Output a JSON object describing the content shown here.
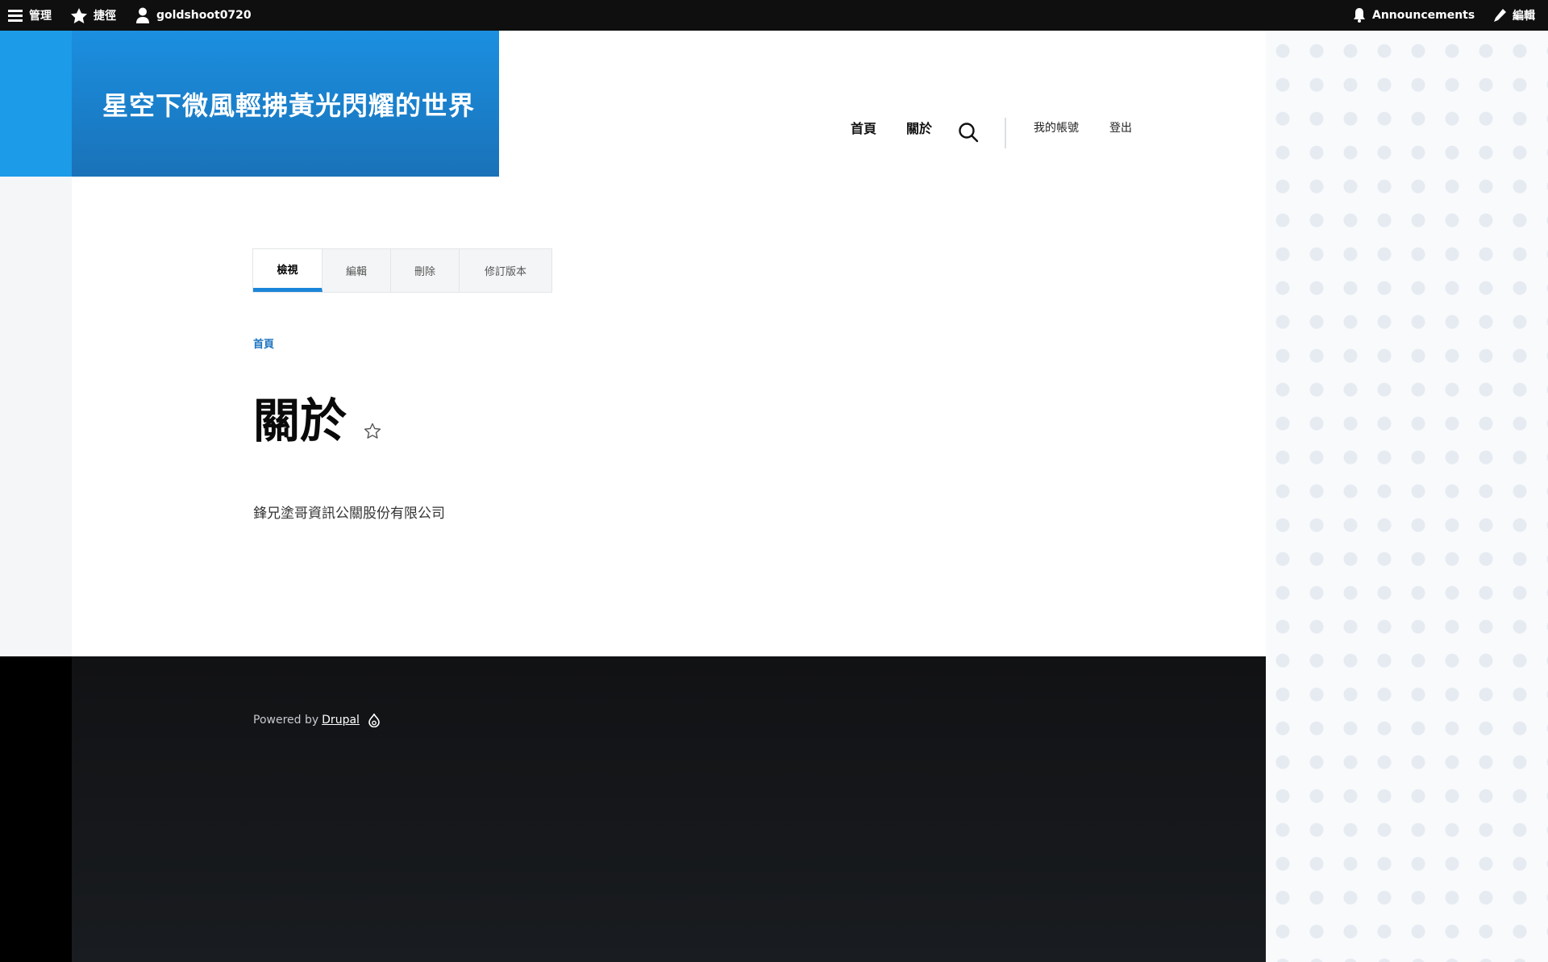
{
  "toolbar": {
    "manage": "管理",
    "shortcuts": "捷徑",
    "user": "goldshoot0720",
    "announcements": "Announcements",
    "edit": "編輯"
  },
  "site": {
    "name": "星空下微風輕拂黃光閃耀的世界"
  },
  "main_nav": {
    "home": "首頁",
    "about": "關於"
  },
  "account_nav": {
    "my_account": "我的帳號",
    "logout": "登出"
  },
  "tabs": [
    {
      "label": "檢視",
      "active": true
    },
    {
      "label": "編輯"
    },
    {
      "label": "刪除"
    },
    {
      "label": "修訂版本"
    }
  ],
  "breadcrumb": {
    "home": "首頁"
  },
  "page": {
    "title": "關於",
    "body": "鋒兄塗哥資訊公關股份有限公司"
  },
  "footer": {
    "powered_by": "Powered by",
    "drupal": "Drupal"
  },
  "colors": {
    "brand_blue": "#1b8fe0",
    "tab_active": "#1b86d9",
    "link_blue": "#1b73c0"
  }
}
